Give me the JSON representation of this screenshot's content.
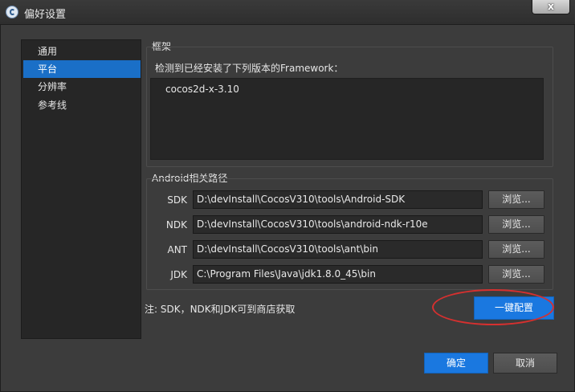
{
  "window": {
    "title": "偏好设置",
    "close_label": "x"
  },
  "sidebar": {
    "items": [
      {
        "label": "通用"
      },
      {
        "label": "平台"
      },
      {
        "label": "分辨率"
      },
      {
        "label": "参考线"
      }
    ]
  },
  "framework": {
    "group_title": "框架",
    "detected_label": "检测到已经安装了下列版本的Framework：",
    "items": [
      "cocos2d-x-3.10"
    ]
  },
  "android": {
    "group_title": "Android相关路径",
    "rows": [
      {
        "label": "SDK",
        "value": "D:\\devInstall\\CocosV310\\tools\\Android-SDK",
        "browse": "浏览..."
      },
      {
        "label": "NDK",
        "value": "D:\\devInstall\\CocosV310\\tools\\android-ndk-r10e",
        "browse": "浏览..."
      },
      {
        "label": "ANT",
        "value": "D:\\devInstall\\CocosV310\\tools\\ant\\bin",
        "browse": "浏览..."
      },
      {
        "label": "JDK",
        "value": "C:\\Program Files\\Java\\jdk1.8.0_45\\bin",
        "browse": "浏览..."
      }
    ]
  },
  "note": "注: SDK，NDK和JDK可到商店获取",
  "one_click_label": "一键配置",
  "footer": {
    "ok_label": "确定",
    "cancel_label": "取消"
  },
  "colors": {
    "accent": "#1a78e0",
    "selected": "#1a6fc7",
    "annotation": "#d6302f"
  }
}
